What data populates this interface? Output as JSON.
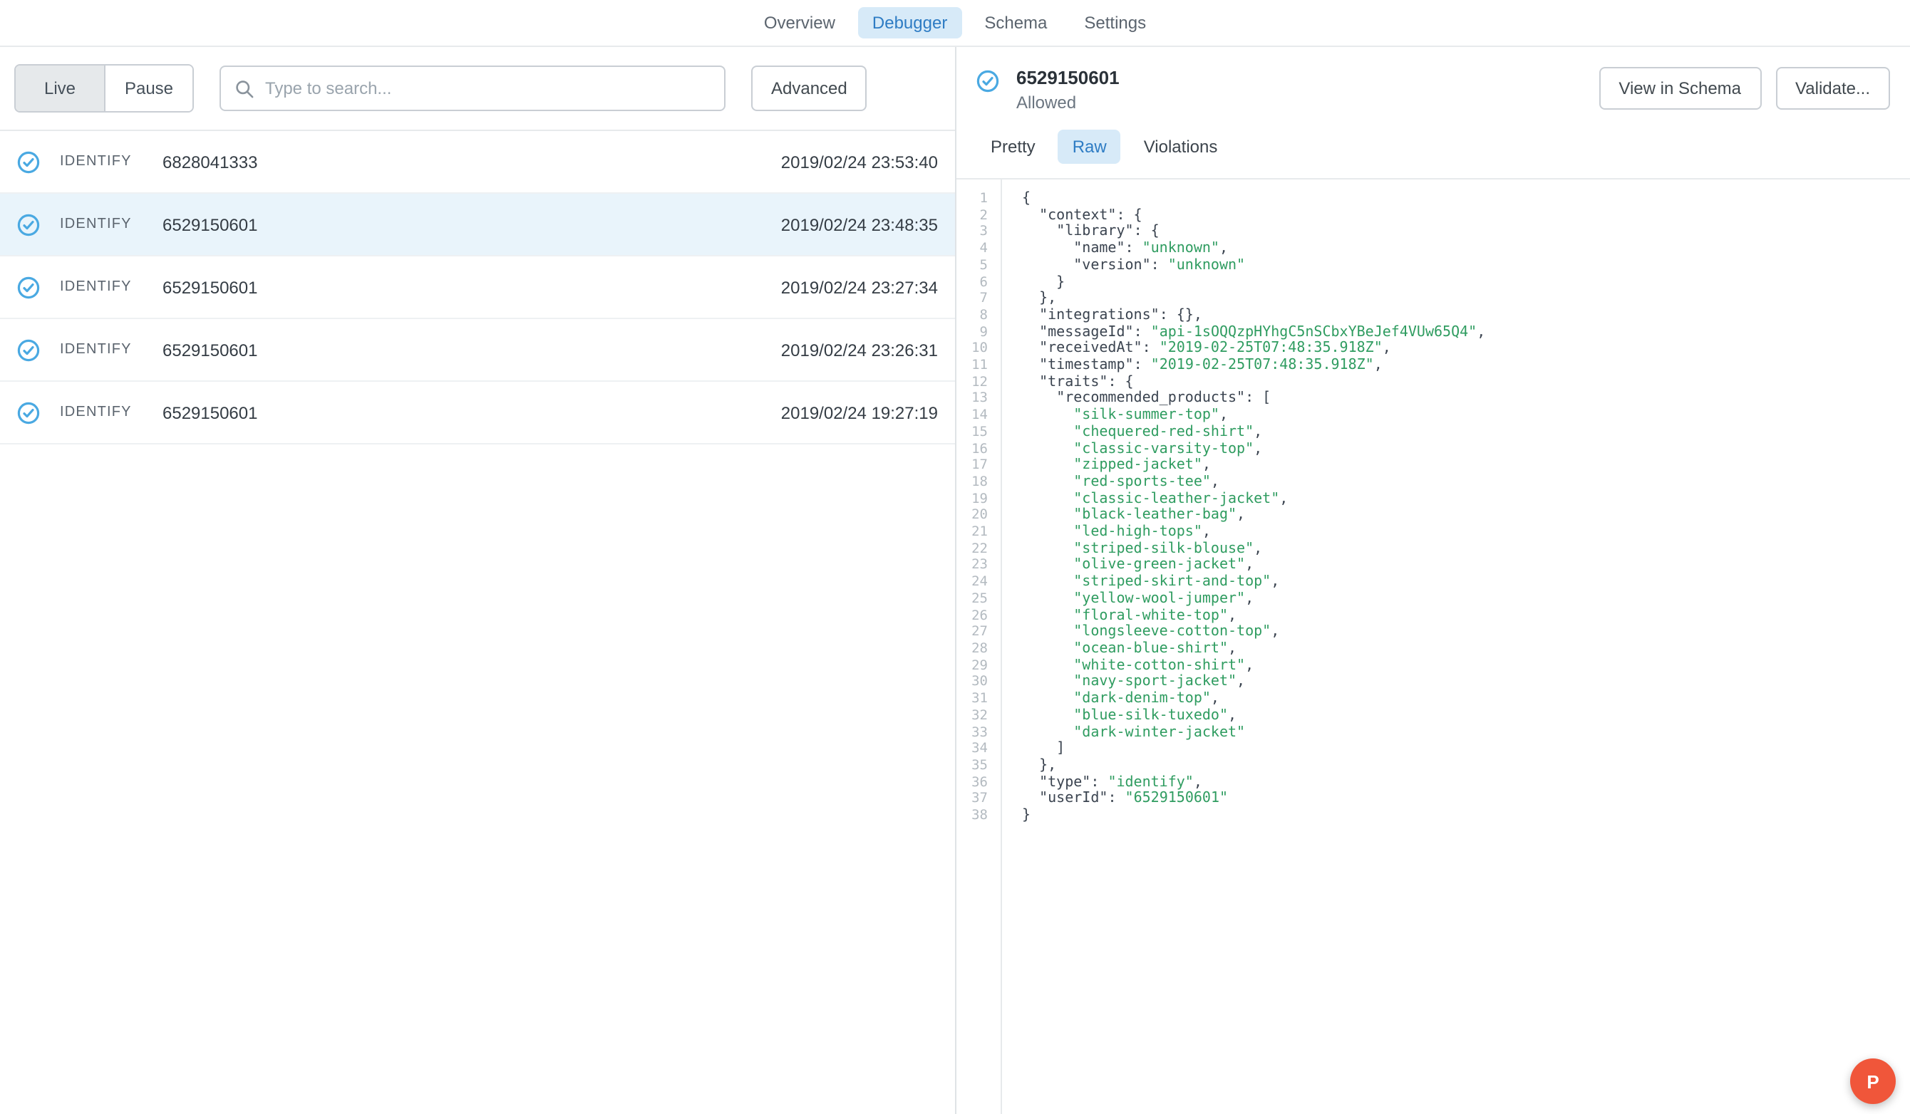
{
  "nav": {
    "tabs": [
      {
        "label": "Overview",
        "active": false
      },
      {
        "label": "Debugger",
        "active": true
      },
      {
        "label": "Schema",
        "active": false
      },
      {
        "label": "Settings",
        "active": false
      }
    ]
  },
  "toolbar": {
    "live_label": "Live",
    "pause_label": "Pause",
    "search_placeholder": "Type to search...",
    "advanced_label": "Advanced"
  },
  "events": [
    {
      "type": "IDENTIFY",
      "user_id": "6828041333",
      "timestamp": "2019/02/24 23:53:40",
      "selected": false
    },
    {
      "type": "IDENTIFY",
      "user_id": "6529150601",
      "timestamp": "2019/02/24 23:48:35",
      "selected": true
    },
    {
      "type": "IDENTIFY",
      "user_id": "6529150601",
      "timestamp": "2019/02/24 23:27:34",
      "selected": false
    },
    {
      "type": "IDENTIFY",
      "user_id": "6529150601",
      "timestamp": "2019/02/24 23:26:31",
      "selected": false
    },
    {
      "type": "IDENTIFY",
      "user_id": "6529150601",
      "timestamp": "2019/02/24 19:27:19",
      "selected": false
    }
  ],
  "detail": {
    "title": "6529150601",
    "status": "Allowed",
    "view_in_schema_label": "View in Schema",
    "validate_label": "Validate...",
    "tabs": [
      {
        "label": "Pretty",
        "active": false
      },
      {
        "label": "Raw",
        "active": true
      },
      {
        "label": "Violations",
        "active": false
      }
    ],
    "code_lines": [
      "{",
      "  \"context\": {",
      "    \"library\": {",
      "      \"name\": \"unknown\",",
      "      \"version\": \"unknown\"",
      "    }",
      "  },",
      "  \"integrations\": {},",
      "  \"messageId\": \"api-1sOQQzpHYhgC5nSCbxYBeJef4VUw65Q4\",",
      "  \"receivedAt\": \"2019-02-25T07:48:35.918Z\",",
      "  \"timestamp\": \"2019-02-25T07:48:35.918Z\",",
      "  \"traits\": {",
      "    \"recommended_products\": [",
      "      \"silk-summer-top\",",
      "      \"chequered-red-shirt\",",
      "      \"classic-varsity-top\",",
      "      \"zipped-jacket\",",
      "      \"red-sports-tee\",",
      "      \"classic-leather-jacket\",",
      "      \"black-leather-bag\",",
      "      \"led-high-tops\",",
      "      \"striped-silk-blouse\",",
      "      \"olive-green-jacket\",",
      "      \"striped-skirt-and-top\",",
      "      \"yellow-wool-jumper\",",
      "      \"floral-white-top\",",
      "      \"longsleeve-cotton-top\",",
      "      \"ocean-blue-shirt\",",
      "      \"white-cotton-shirt\",",
      "      \"navy-sport-jacket\",",
      "      \"dark-denim-top\",",
      "      \"blue-silk-tuxedo\",",
      "      \"dark-winter-jacket\"",
      "    ]",
      "  },",
      "  \"type\": \"identify\",",
      "  \"userId\": \"6529150601\"",
      "}"
    ]
  },
  "fab": {
    "label": "P"
  },
  "colors": {
    "accent": "#2e7cc4",
    "accent_bg": "#d7eaf8",
    "icon_blue": "#4aa9e2",
    "string_green": "#2f9c60",
    "fab_orange": "#f0563a"
  }
}
